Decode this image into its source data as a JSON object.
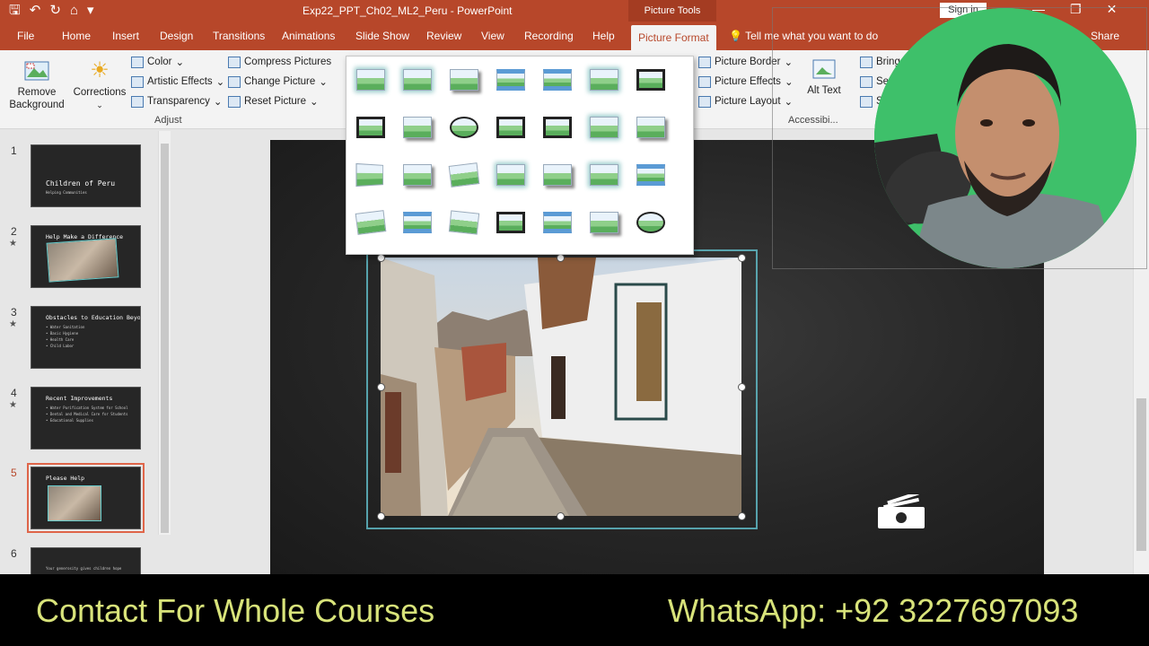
{
  "window": {
    "title": "Exp22_PPT_Ch02_ML2_Peru  -  PowerPoint",
    "context_tab_group": "Picture Tools",
    "sign_in": "Sign in",
    "minimize": "—",
    "restore": "❐",
    "close": "✕"
  },
  "tabs": [
    {
      "label": "File"
    },
    {
      "label": "Home"
    },
    {
      "label": "Insert"
    },
    {
      "label": "Design"
    },
    {
      "label": "Transitions"
    },
    {
      "label": "Animations"
    },
    {
      "label": "Slide Show"
    },
    {
      "label": "Review"
    },
    {
      "label": "View"
    },
    {
      "label": "Recording"
    },
    {
      "label": "Help"
    },
    {
      "label": "Picture Format",
      "active": true
    }
  ],
  "tell_me": "Tell me what you want to do",
  "share": "Share",
  "ribbon": {
    "remove_background": "Remove Background",
    "corrections": "Corrections",
    "color": "Color",
    "artistic_effects": "Artistic Effects",
    "transparency": "Transparency",
    "compress_pictures": "Compress Pictures",
    "change_picture": "Change Picture",
    "reset_picture": "Reset Picture",
    "adjust_group": "Adjust",
    "picture_border": "Picture Border",
    "picture_effects": "Picture Effects",
    "picture_layout": "Picture Layout",
    "alt_text": "Alt Text",
    "accessibility_group": "Accessibi...",
    "bring_forward": "Bring",
    "send_backward": "Se",
    "selection": "S"
  },
  "slides": [
    {
      "num": "1",
      "title": "Children of Peru",
      "lines": [
        "Helping Communities"
      ],
      "star": false
    },
    {
      "num": "2",
      "title": "Help Make a Difference",
      "lines": [],
      "star": true
    },
    {
      "num": "3",
      "title": "Obstacles to Education Beyond 6th Grade",
      "lines": [
        "• Water Sanitation",
        "• Basic Hygiene",
        "• Health Care",
        "• Child Labor"
      ],
      "star": true
    },
    {
      "num": "4",
      "title": "Recent Improvements",
      "lines": [
        "• Water Purification System for School",
        "• Dental and Medical Care for Students",
        "• Educational Supplies"
      ],
      "star": true
    },
    {
      "num": "5",
      "title": "Please Help",
      "lines": [],
      "star": false,
      "selected": true
    },
    {
      "num": "6",
      "title": "",
      "lines": [
        "Your generosity gives children hope"
      ],
      "star": false
    }
  ],
  "style_gallery_count": 28,
  "banner": {
    "left": "Contact For Whole Courses",
    "right": "WhatsApp:  +92 3227697093"
  },
  "colors": {
    "accent": "#b7472a",
    "banner_text": "#d8e37a",
    "frame_line": "#5fb8c4"
  }
}
